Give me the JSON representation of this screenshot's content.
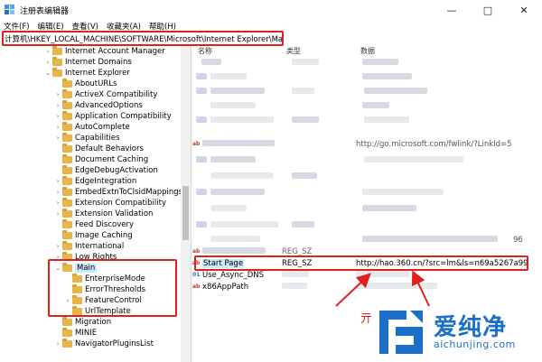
{
  "window": {
    "title": "注册表编辑器",
    "controls": [
      "—",
      "□",
      "✕"
    ]
  },
  "menu": [
    "文件(F)",
    "编辑(E)",
    "查看(V)",
    "收藏夹(A)",
    "帮助(H)"
  ],
  "address": "计算机\\HKEY_LOCAL_MACHINE\\SOFTWARE\\Microsoft\\Internet Explorer\\Main",
  "tree": [
    {
      "label": "Internet Account Manager",
      "chev": "›",
      "indent": 0
    },
    {
      "label": "Internet Domains",
      "chev": "›",
      "indent": 0
    },
    {
      "label": "Internet Explorer",
      "chev": "⌄",
      "indent": 0
    },
    {
      "label": "AboutURLs",
      "chev": "",
      "indent": 1
    },
    {
      "label": "ActiveX Compatibility",
      "chev": "›",
      "indent": 1
    },
    {
      "label": "AdvancedOptions",
      "chev": "›",
      "indent": 1
    },
    {
      "label": "Application Compatibility",
      "chev": "›",
      "indent": 1
    },
    {
      "label": "AutoComplete",
      "chev": "›",
      "indent": 1
    },
    {
      "label": "Capabilities",
      "chev": "›",
      "indent": 1
    },
    {
      "label": "Default Behaviors",
      "chev": "",
      "indent": 1
    },
    {
      "label": "Document Caching",
      "chev": "",
      "indent": 1
    },
    {
      "label": "EdgeDebugActivation",
      "chev": "",
      "indent": 1
    },
    {
      "label": "EdgeIntegration",
      "chev": "›",
      "indent": 1
    },
    {
      "label": "EmbedExtnToClsidMappings",
      "chev": "›",
      "indent": 1
    },
    {
      "label": "Extension Compatibility",
      "chev": "›",
      "indent": 1
    },
    {
      "label": "Extension Validation",
      "chev": "›",
      "indent": 1
    },
    {
      "label": "Feed Discovery",
      "chev": "",
      "indent": 1
    },
    {
      "label": "Image Caching",
      "chev": "",
      "indent": 1
    },
    {
      "label": "International",
      "chev": "›",
      "indent": 1
    },
    {
      "label": "Low Rights",
      "chev": "›",
      "indent": 1
    },
    {
      "label": "Main",
      "chev": "⌄",
      "indent": 1,
      "selected": true
    },
    {
      "label": "EnterpriseMode",
      "chev": "",
      "indent": 2
    },
    {
      "label": "ErrorThresholds",
      "chev": "",
      "indent": 2
    },
    {
      "label": "FeatureControl",
      "chev": "›",
      "indent": 2
    },
    {
      "label": "UrlTemplate",
      "chev": "",
      "indent": 2
    },
    {
      "label": "Migration",
      "chev": "",
      "indent": 1
    },
    {
      "label": "MINIE",
      "chev": "",
      "indent": 1
    },
    {
      "label": "NavigatorPluginsList",
      "chev": "›",
      "indent": 1
    }
  ],
  "columns": {
    "name": "名称",
    "type": "类型",
    "data": "数据"
  },
  "values": {
    "partial_url": "http://go.microsoft.com/fwlink/?LinkId=5",
    "partial_type": "REG_SZ",
    "partial_num": "96",
    "rows": [
      {
        "icon": "ab",
        "name": "Start Page",
        "type": "REG_SZ",
        "data": "http://hao.360.cn/?src=lm&ls=n69a5267a99",
        "selected": true
      },
      {
        "icon": "bin",
        "name": "Use_Async_DNS",
        "type": "",
        "data": ""
      },
      {
        "icon": "ab",
        "name": "x86AppPath",
        "type": "",
        "data": ""
      }
    ]
  },
  "watermark": {
    "title": "爱纯净",
    "url": "aichunjing.com",
    "red_text": "亓"
  }
}
